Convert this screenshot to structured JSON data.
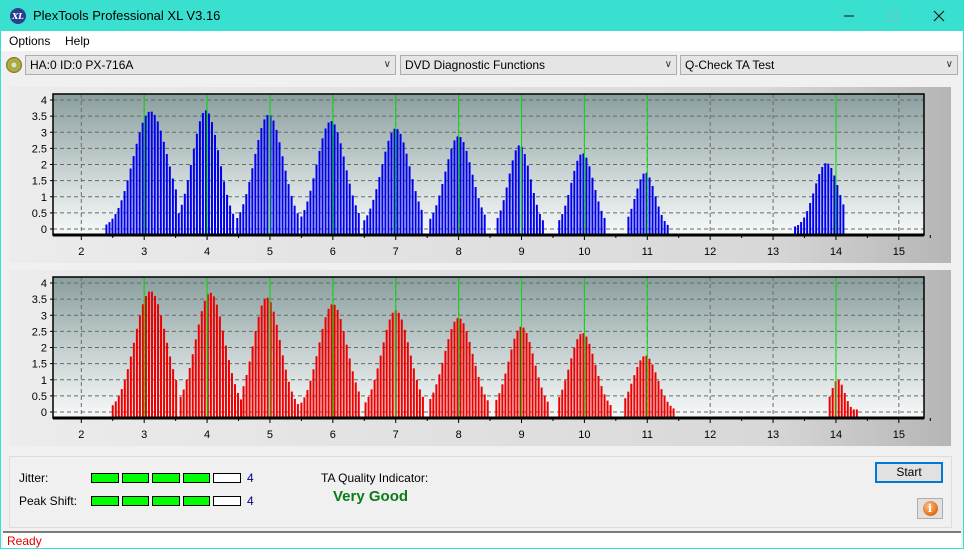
{
  "window": {
    "title": "PlexTools Professional XL V3.16",
    "app_icon": "XL",
    "controls": {
      "minimize": "minimize-icon",
      "maximize": "maximize-icon",
      "close": "close-icon"
    }
  },
  "menu": [
    "Options",
    "Help"
  ],
  "toolbar": {
    "drive": "HA:0 ID:0  PX-716A",
    "function": "DVD Diagnostic Functions",
    "test": "Q-Check TA Test"
  },
  "charts": {
    "colors": {
      "top_series": "#0000ee",
      "bottom_series": "#ee0000",
      "marker": "#00e000"
    }
  },
  "chart_data": [
    {
      "type": "bar",
      "title": "",
      "name": "TA histogram (top)",
      "xlim": [
        1.55,
        15.4
      ],
      "ylim": [
        0,
        4.15
      ],
      "x_ticks": [
        2,
        3,
        4,
        5,
        6,
        7,
        8,
        9,
        10,
        11,
        12,
        13,
        14,
        15
      ],
      "y_ticks": [
        "0",
        "0.5",
        "1",
        "1.5",
        "2",
        "2.5",
        "3",
        "3.5",
        "4"
      ],
      "y_tick_values": [
        0,
        0.5,
        1,
        1.5,
        2,
        2.5,
        3,
        3.5,
        4
      ],
      "markers": [
        3,
        4,
        5,
        6,
        7,
        8,
        9,
        10,
        11,
        14
      ],
      "grid": true,
      "color": "#0000ee",
      "peaks": [
        {
          "center": 3.1,
          "height": 3.65,
          "from": 2.4,
          "to": 3.55
        },
        {
          "center": 3.98,
          "height": 3.68,
          "from": 3.55,
          "to": 4.45
        },
        {
          "center": 4.98,
          "height": 3.55,
          "from": 4.48,
          "to": 5.45
        },
        {
          "center": 5.97,
          "height": 3.35,
          "from": 5.5,
          "to": 6.45
        },
        {
          "center": 7.0,
          "height": 3.12,
          "from": 6.5,
          "to": 7.45
        },
        {
          "center": 8.0,
          "height": 2.88,
          "from": 7.55,
          "to": 8.45
        },
        {
          "center": 8.97,
          "height": 2.6,
          "from": 8.62,
          "to": 9.35
        },
        {
          "center": 9.97,
          "height": 2.35,
          "from": 9.6,
          "to": 10.35
        },
        {
          "center": 10.97,
          "height": 1.75,
          "from": 10.7,
          "to": 11.35
        },
        {
          "center": 13.85,
          "height": 2.05,
          "from": 13.35,
          "to": 14.15
        }
      ]
    },
    {
      "type": "bar",
      "title": "",
      "name": "TA histogram (bottom)",
      "xlim": [
        1.55,
        15.4
      ],
      "ylim": [
        0,
        4.15
      ],
      "x_ticks": [
        2,
        3,
        4,
        5,
        6,
        7,
        8,
        9,
        10,
        11,
        12,
        13,
        14,
        15
      ],
      "y_ticks": [
        "0",
        "0.5",
        "1",
        "1.5",
        "2",
        "2.5",
        "3",
        "3.5",
        "4"
      ],
      "y_tick_values": [
        0,
        0.5,
        1,
        1.5,
        2,
        2.5,
        3,
        3.5,
        4
      ],
      "markers": [
        3,
        4,
        5,
        6,
        7,
        8,
        9,
        10,
        11,
        14
      ],
      "grid": true,
      "color": "#ee0000",
      "peaks": [
        {
          "center": 3.1,
          "height": 3.75,
          "from": 2.5,
          "to": 3.55
        },
        {
          "center": 4.05,
          "height": 3.7,
          "from": 3.58,
          "to": 4.55
        },
        {
          "center": 4.95,
          "height": 3.55,
          "from": 4.58,
          "to": 5.48
        },
        {
          "center": 6.0,
          "height": 3.35,
          "from": 5.5,
          "to": 6.45
        },
        {
          "center": 7.0,
          "height": 3.15,
          "from": 6.52,
          "to": 7.45
        },
        {
          "center": 8.0,
          "height": 2.92,
          "from": 7.55,
          "to": 8.5
        },
        {
          "center": 9.0,
          "height": 2.65,
          "from": 8.6,
          "to": 9.45
        },
        {
          "center": 9.97,
          "height": 2.45,
          "from": 9.6,
          "to": 10.45
        },
        {
          "center": 10.97,
          "height": 1.75,
          "from": 10.65,
          "to": 11.45
        },
        {
          "center": 14.03,
          "height": 1.0,
          "from": 13.9,
          "to": 14.35
        }
      ]
    }
  ],
  "results": {
    "jitter_label": "Jitter:",
    "jitter_value": "4",
    "jitter_level": 4,
    "peak_shift_label": "Peak Shift:",
    "peak_shift_value": "4",
    "peak_shift_level": 4,
    "meter_max": 5,
    "ta_quality_label": "TA Quality Indicator:",
    "ta_quality_value": "Very Good"
  },
  "buttons": {
    "start": "Start",
    "info": "i"
  },
  "status": "Ready"
}
